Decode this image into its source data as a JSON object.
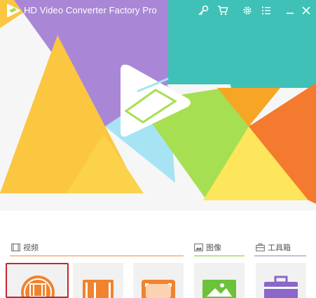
{
  "window": {
    "title": "HD Video Converter Factory Pro"
  },
  "titlebar_buttons": [
    {
      "name": "key-icon"
    },
    {
      "name": "cart-icon"
    },
    {
      "name": "gear-icon"
    },
    {
      "name": "list-icon"
    },
    {
      "name": "minimize-icon"
    },
    {
      "name": "close-icon"
    }
  ],
  "sections": {
    "video": {
      "label": "视频",
      "icon": "film-icon"
    },
    "image": {
      "label": "图像",
      "icon": "image-icon"
    },
    "toolbox": {
      "label": "工具箱",
      "icon": "toolbox-icon"
    }
  },
  "colors": {
    "teal": "#3fc1b7",
    "purple": "#a987d6",
    "yellow": "#fbc640",
    "orange": "#f47a2f",
    "green": "#a7df52",
    "light_blue": "#a6e4f4",
    "selected_border": "#c0282f"
  }
}
